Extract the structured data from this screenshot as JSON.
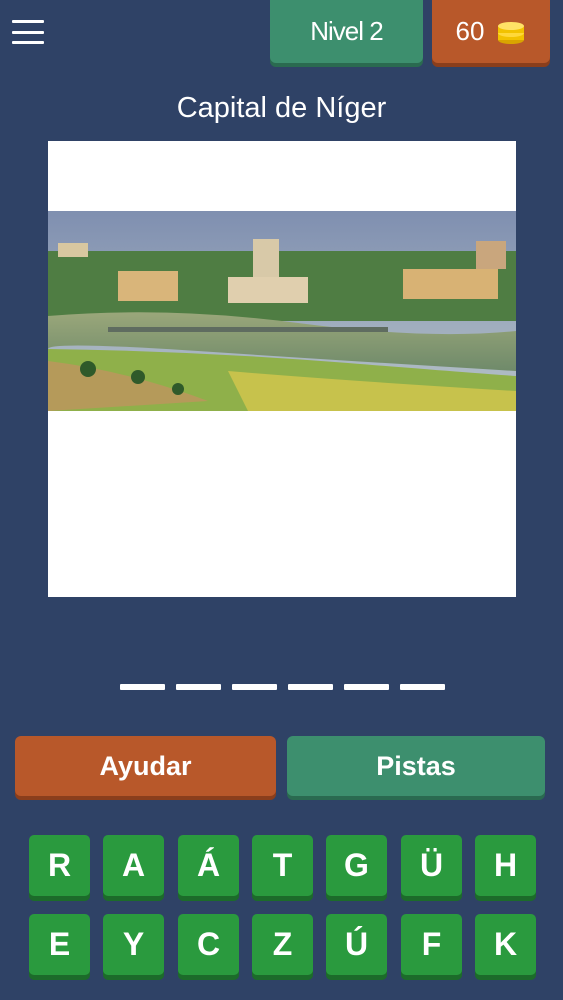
{
  "header": {
    "menu_icon": "hamburger-menu-icon",
    "level_label": "Nivel 2",
    "coins": "60",
    "coin_icon": "coin-stack-icon"
  },
  "question": {
    "text": "Capital de Níger"
  },
  "answer": {
    "slot_count": 6
  },
  "actions": {
    "help_label": "Ayudar",
    "hints_label": "Pistas"
  },
  "keyboard": {
    "row1": [
      "R",
      "A",
      "Á",
      "T",
      "G",
      "Ü",
      "H"
    ],
    "row2": [
      "E",
      "Y",
      "C",
      "Z",
      "Ú",
      "F",
      "K"
    ]
  },
  "colors": {
    "background": "#2f4266",
    "green_button": "#3d8f6e",
    "orange_button": "#b8582a",
    "key_green": "#2a9a3e"
  }
}
